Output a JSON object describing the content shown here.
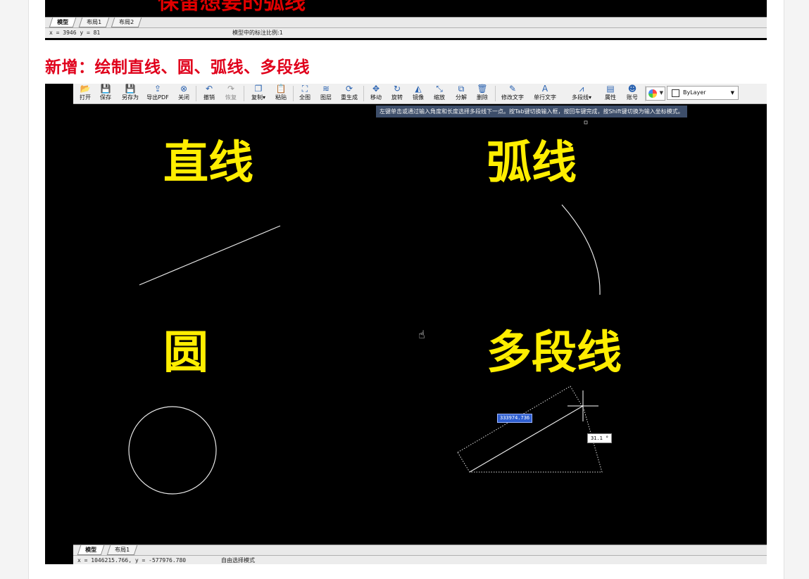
{
  "top_screenshot": {
    "banner_text": "保留想要的弧线",
    "tabs": [
      {
        "label": "模型",
        "active": true
      },
      {
        "label": "布局1",
        "active": false
      },
      {
        "label": "布局2",
        "active": false
      }
    ],
    "status": {
      "coords": "x = 3946  y = 81",
      "mode": "模型中的标注比例:1"
    }
  },
  "heading": "新增：绘制直线、圆、弧线、多段线",
  "toolbar": {
    "items": [
      {
        "label": "打开",
        "icon": "📂"
      },
      {
        "label": "保存",
        "icon": "💾"
      },
      {
        "label": "另存为",
        "icon": "💾"
      },
      {
        "label": "导出PDF",
        "icon": "⇪"
      },
      {
        "label": "关闭",
        "icon": "⊗"
      },
      {
        "label": "撤销",
        "icon": "↶"
      },
      {
        "label": "恢复",
        "icon": "↷"
      },
      {
        "label": "复制▾",
        "icon": "❐"
      },
      {
        "label": "粘贴",
        "icon": "📋"
      },
      {
        "label": "全图",
        "icon": "⛶"
      },
      {
        "label": "图层",
        "icon": "≋"
      },
      {
        "label": "重生成",
        "icon": "⟳"
      },
      {
        "label": "移动",
        "icon": "✥"
      },
      {
        "label": "旋转",
        "icon": "↻"
      },
      {
        "label": "镜像",
        "icon": "◭"
      },
      {
        "label": "缩放",
        "icon": "⤡"
      },
      {
        "label": "分解",
        "icon": "⧉"
      },
      {
        "label": "删除",
        "icon": "🗑"
      },
      {
        "label": "修改文字",
        "icon": "✎"
      },
      {
        "label": "单行文字",
        "icon": "A"
      },
      {
        "label": "多段线▾",
        "icon": "⩘"
      },
      {
        "label": "属性",
        "icon": "▤"
      },
      {
        "label": "账号",
        "icon": "☻"
      }
    ],
    "layer": "ByLayer"
  },
  "tooltip": "左键单击或通过输入角度和长度选择多段线下一点。按Tab键切换输入框，按回车键完成，按Shift键切换为输入坐标模式。",
  "labels": {
    "line": "直线",
    "arc": "弧线",
    "circle": "圆",
    "polyline": "多段线"
  },
  "dim_input": "333974.736",
  "angle_input": "31.1 °",
  "bottom": {
    "tabs": [
      {
        "label": "模型",
        "active": true
      },
      {
        "label": "布局1",
        "active": false
      }
    ],
    "coords": "x = 1046215.766,  y = -577976.780",
    "mode": "自由选择模式"
  },
  "colors": {
    "heading": "#e0001b",
    "label_yellow": "#ffee00",
    "canvas": "#000000"
  }
}
